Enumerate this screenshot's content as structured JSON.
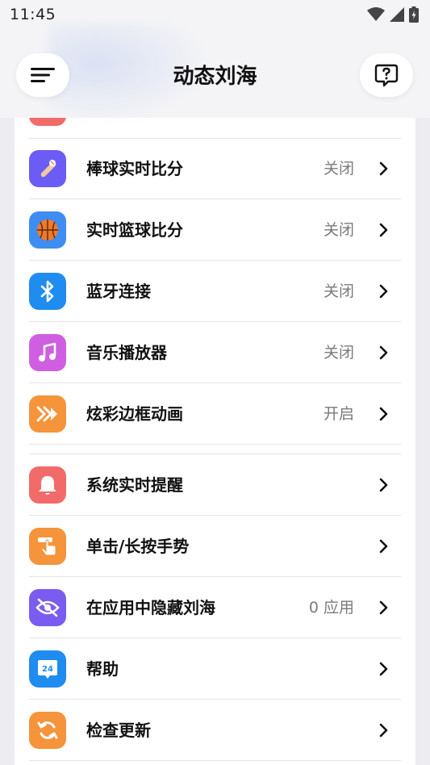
{
  "status": {
    "time": "11:45"
  },
  "header": {
    "title": "动态刘海"
  },
  "rows": [
    {
      "label": "棒球实时比分",
      "value": "关闭",
      "icon": "baseball-icon",
      "color": "#6b5cf5"
    },
    {
      "label": "实时篮球比分",
      "value": "关闭",
      "icon": "basketball-icon",
      "color": "#3e8df2"
    },
    {
      "label": "蓝牙连接",
      "value": "关闭",
      "icon": "bluetooth-icon",
      "color": "#1f8cf0"
    },
    {
      "label": "音乐播放器",
      "value": "关闭",
      "icon": "music-note-icon",
      "color": "#cf5fe0"
    },
    {
      "label": "炫彩边框动画",
      "value": "开启",
      "icon": "animation-icon",
      "color": "#f5943a"
    },
    {
      "label": "系统实时提醒",
      "value": "",
      "icon": "bell-icon",
      "color": "#f26b6b"
    },
    {
      "label": "单击/长按手势",
      "value": "",
      "icon": "gesture-icon",
      "color": "#f5943a"
    },
    {
      "label": "在应用中隐藏刘海",
      "value": "0 应用",
      "icon": "eye-off-icon",
      "color": "#7a5cf0"
    },
    {
      "label": "帮助",
      "value": "",
      "icon": "help-24-icon",
      "color": "#1f8cf0"
    },
    {
      "label": "检查更新",
      "value": "",
      "icon": "refresh-icon",
      "color": "#f5943a"
    }
  ]
}
